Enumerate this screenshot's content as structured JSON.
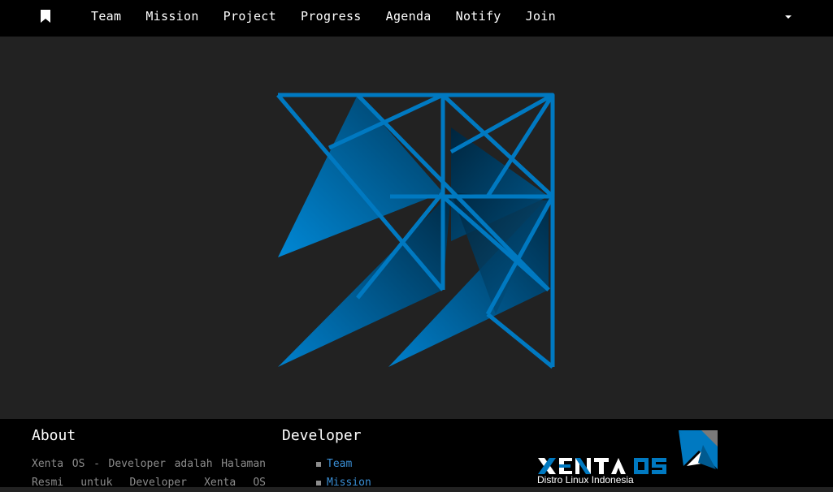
{
  "nav": {
    "items": [
      {
        "label": "Team"
      },
      {
        "label": "Mission"
      },
      {
        "label": "Project"
      },
      {
        "label": "Progress"
      },
      {
        "label": "Agenda"
      },
      {
        "label": "Notify"
      },
      {
        "label": "Join"
      }
    ],
    "logo_icon": "bookmark-icon",
    "dropdown_icon": "caret-down-icon"
  },
  "hero": {
    "logo_icon": "xenta-geometric-logo",
    "colors": {
      "primary": "#0079c1",
      "dark": "#00304d"
    }
  },
  "footer": {
    "about": {
      "title": "About",
      "text": "Xenta OS - Developer adalah Halaman Resmi untuk Developer Xenta OS"
    },
    "developer": {
      "title": "Developer",
      "links": [
        {
          "label": "Team"
        },
        {
          "label": "Mission"
        }
      ]
    },
    "brand": {
      "name": "XENTA OS",
      "tagline": "Distro Linux Indonesia"
    }
  },
  "colors": {
    "nav_bg": "#000000",
    "page_bg": "#222222",
    "link": "#3a8fd6",
    "muted_text": "#8c8c8c"
  }
}
